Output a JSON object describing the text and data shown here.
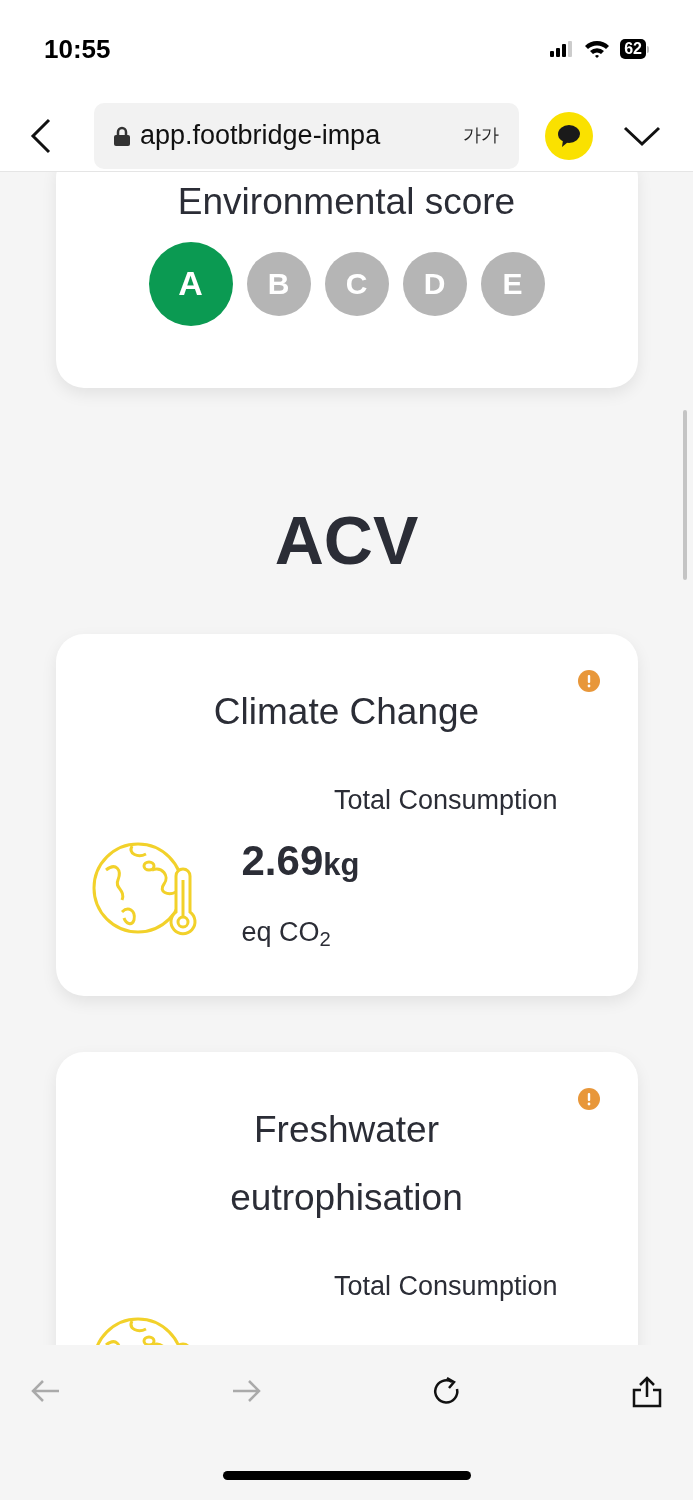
{
  "status_bar": {
    "time": "10:55",
    "battery": "62"
  },
  "browser": {
    "url": "app.footbridge-impa",
    "text_size": "가가"
  },
  "score_card": {
    "title": "Environmental score",
    "grades": [
      {
        "label": "A",
        "selected": true
      },
      {
        "label": "B",
        "selected": false
      },
      {
        "label": "C",
        "selected": false
      },
      {
        "label": "D",
        "selected": false
      },
      {
        "label": "E",
        "selected": false
      }
    ]
  },
  "section_title": "ACV",
  "impact_cards": [
    {
      "title": "Climate Change",
      "warning": true,
      "label": "Total Consumption",
      "value": "2.69",
      "unit": "kg",
      "unit_note": "eq CO$_{2}$"
    },
    {
      "title": "Freshwater eutrophisation",
      "warning": true,
      "label": "Total Consumption"
    }
  ],
  "toolbar": [
    {
      "kind": "back",
      "disabled": true
    },
    {
      "kind": "forward",
      "disabled": true
    },
    {
      "kind": "reload",
      "disabled": false
    },
    {
      "kind": "share",
      "disabled": false
    }
  ]
}
